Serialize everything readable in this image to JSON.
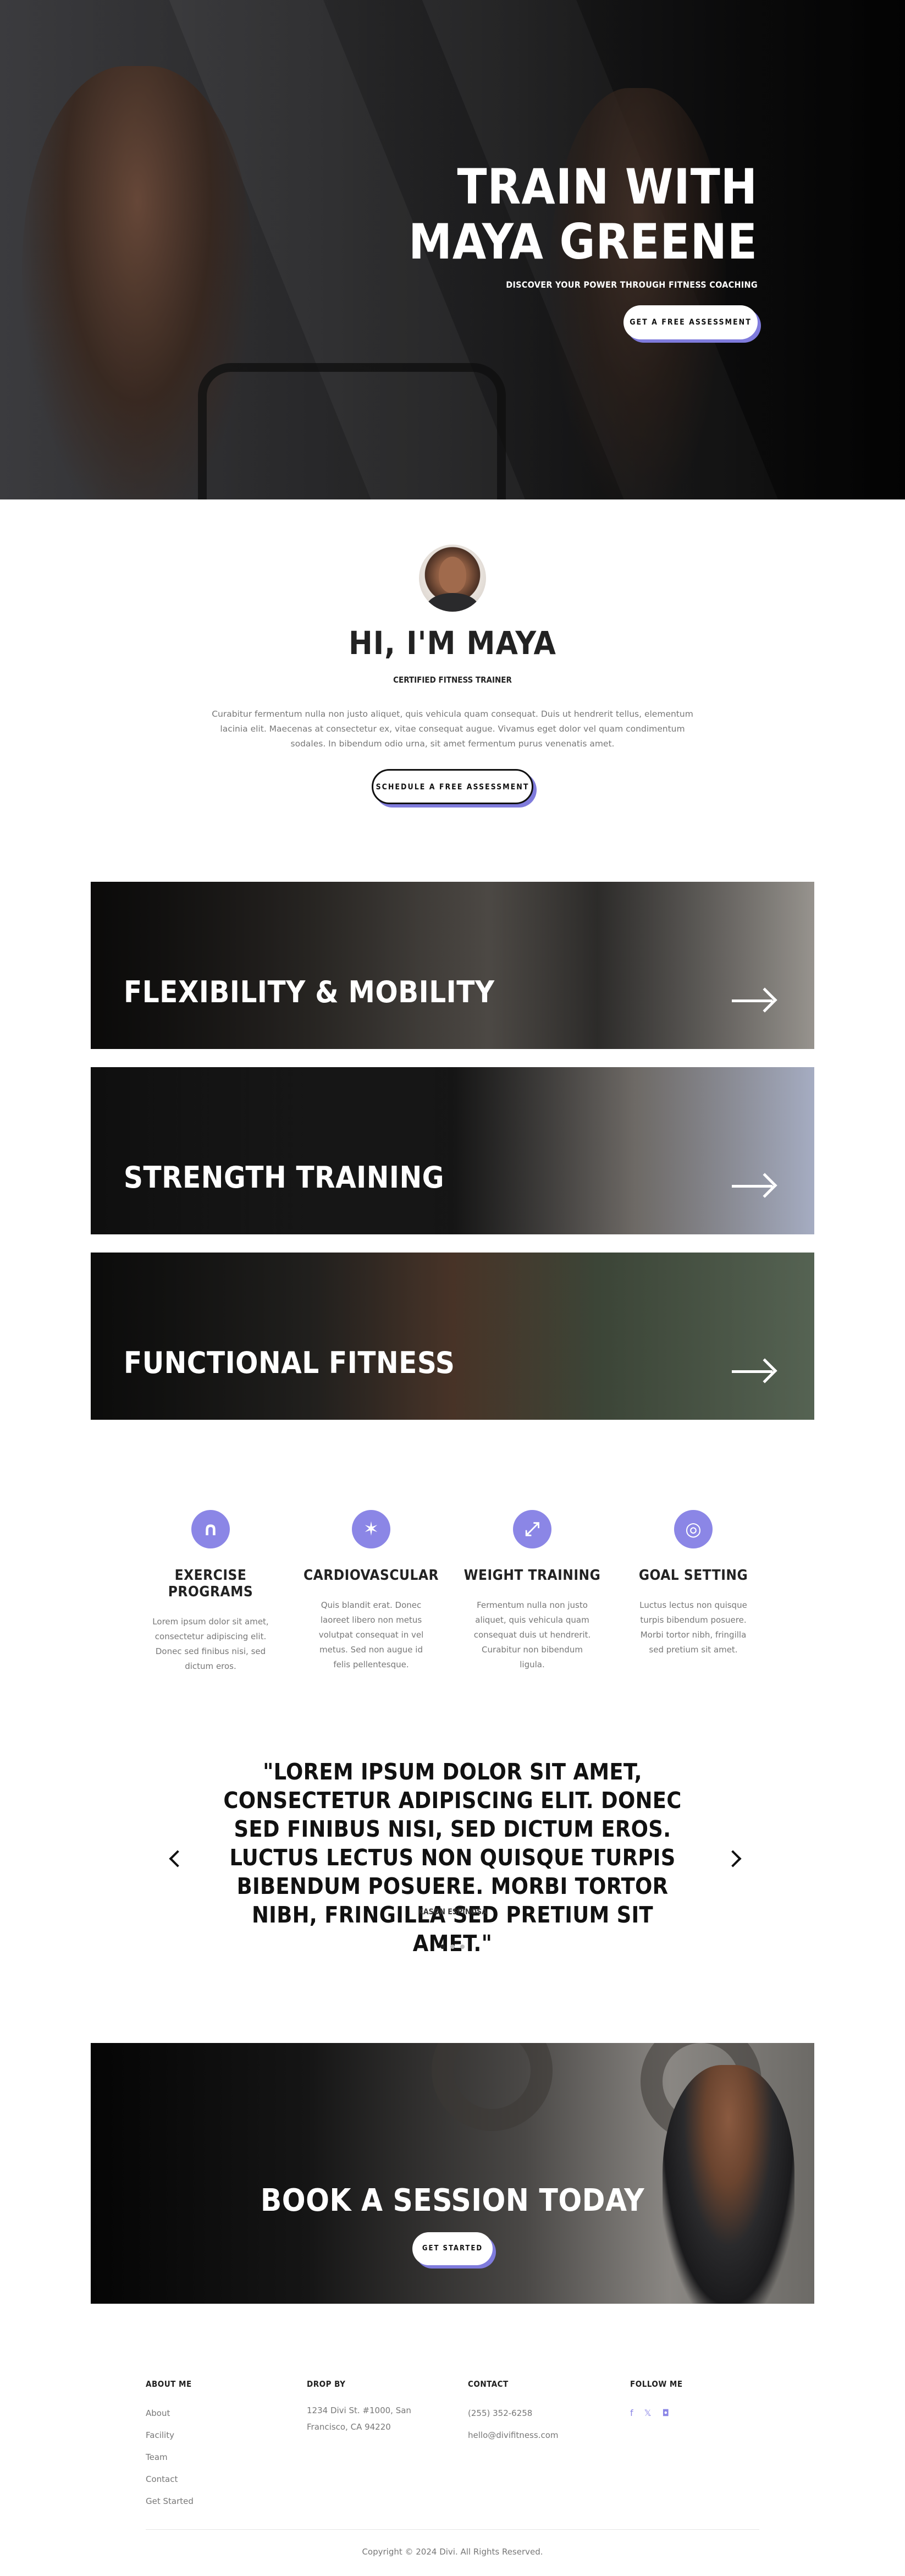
{
  "hero": {
    "title_line1": "TRAIN WITH",
    "title_line2": "MAYA GREENE",
    "subtitle": "DISCOVER YOUR POWER THROUGH FITNESS COACHING",
    "button": "GET A FREE ASSESSMENT"
  },
  "intro": {
    "title": "HI, I'M MAYA",
    "subtitle": "CERTIFIED FITNESS TRAINER",
    "text": "Curabitur fermentum nulla non justo aliquet, quis vehicula quam consequat. Duis ut hendrerit tellus, elementum lacinia elit. Maecenas at consectetur ex, vitae consequat augue. Vivamus eget dolor vel quam condimentum sodales. In bibendum odio urna, sit amet fermentum purus venenatis amet.",
    "button": "SCHEDULE A FREE ASSESSMENT"
  },
  "services": [
    {
      "title": "FLEXIBILITY & MOBILITY"
    },
    {
      "title": "STRENGTH TRAINING"
    },
    {
      "title": "FUNCTIONAL FITNESS"
    }
  ],
  "features": [
    {
      "icon": "jump-rope-icon",
      "title": "EXERCISE PROGRAMS",
      "text": "Lorem ipsum dolor sit amet, consectetur adipiscing elit. Donec sed finibus nisi, sed dictum eros."
    },
    {
      "icon": "running-icon",
      "title": "CARDIOVASCULAR",
      "text": "Quis blandit erat. Donec laoreet libero non metus volutpat consequat in vel metus. Sed non augue id felis pellentesque."
    },
    {
      "icon": "dumbbell-icon",
      "title": "WEIGHT TRAINING",
      "text": "Fermentum nulla non justo aliquet, quis vehicula quam consequat duis ut hendrerit. Curabitur non bibendum ligula."
    },
    {
      "icon": "target-icon",
      "title": "GOAL SETTING",
      "text": "Luctus lectus non quisque turpis bibendum posuere. Morbi tortor nibh, fringilla sed pretium sit amet."
    }
  ],
  "testimonial": {
    "quote": "\"LOREM IPSUM DOLOR SIT AMET, CONSECTETUR ADIPISCING ELIT. DONEC SED FINIBUS NISI, SED DICTUM EROS. LUCTUS LECTUS NON QUISQUE TURPIS BIBENDUM POSUERE. MORBI TORTOR NIBH, FRINGILLA SED PRETIUM SIT AMET.\"",
    "author": "KASON ESPINOSA"
  },
  "cta": {
    "title": "BOOK A SESSION TODAY",
    "button": "GET STARTED"
  },
  "footer": {
    "about": {
      "heading": "ABOUT ME",
      "links": [
        "About",
        "Facility",
        "Team",
        "Contact",
        "Get Started"
      ]
    },
    "drop_by": {
      "heading": "DROP BY",
      "address": "1234 Divi St. #1000, San Francisco, CA 94220"
    },
    "contact": {
      "heading": "CONTACT",
      "phone": "(255) 352-6258",
      "email": "hello@divifitness.com"
    },
    "follow": {
      "heading": "FOLLOW ME",
      "icons": [
        "facebook-icon",
        "x-icon",
        "instagram-icon"
      ]
    },
    "copyright": "Copyright © 2024 Divi. All Rights Reserved."
  },
  "colors": {
    "accent": "#8b86e6",
    "button_shadow": "#7f7bdc"
  }
}
